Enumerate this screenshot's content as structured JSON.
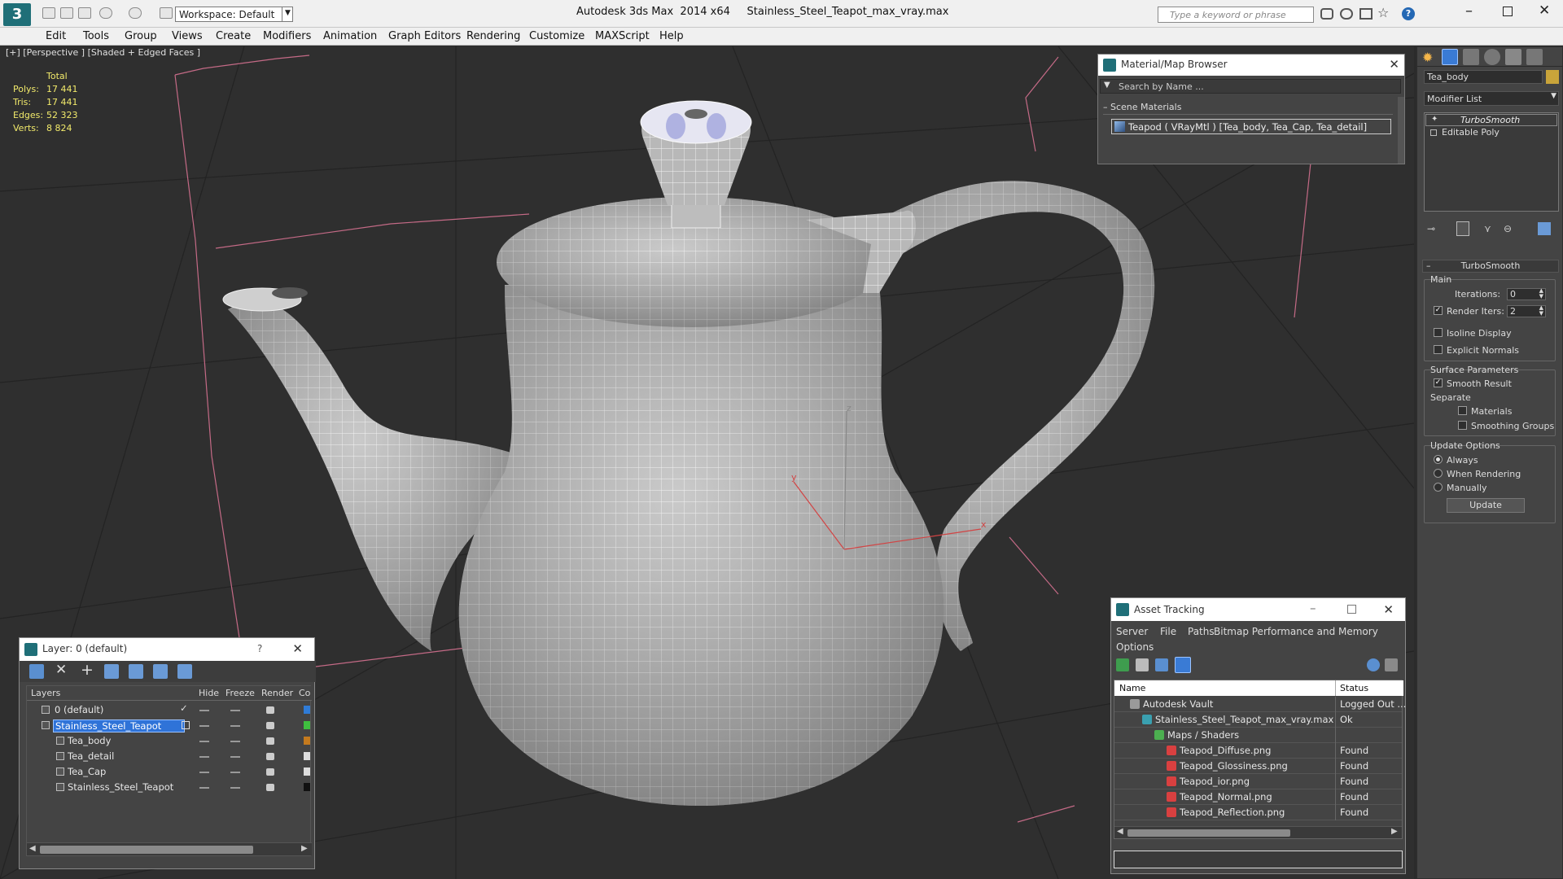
{
  "app": {
    "title": "Autodesk 3ds Max  2014 x64     Stainless_Steel_Teapot_max_vray.max",
    "workspace": "Workspace: Default",
    "search_placeholder": "Type a keyword or phrase"
  },
  "menu": [
    "Edit",
    "Tools",
    "Group",
    "Views",
    "Create",
    "Modifiers",
    "Animation",
    "Graph Editors",
    "Rendering",
    "Customize",
    "MAXScript",
    "Help"
  ],
  "viewport": {
    "label": "[+] [Perspective ] [Shaded + Edged Faces ]",
    "stats_header": "Total",
    "stats": [
      {
        "label": "Polys:",
        "value": "17 441"
      },
      {
        "label": "Tris:",
        "value": "17 441"
      },
      {
        "label": "Edges:",
        "value": "52 323"
      },
      {
        "label": "Verts:",
        "value": "8 824"
      }
    ],
    "axis_x": "x",
    "axis_y": "y",
    "axis_z": "z"
  },
  "material_browser": {
    "title": "Material/Map Browser",
    "search_placeholder": "Search by Name ...",
    "section": "Scene Materials",
    "item": "Teapod  ( VRayMtl ) [Tea_body, Tea_Cap, Tea_detail]"
  },
  "layer_panel": {
    "title": "Layer: 0 (default)",
    "help": "?",
    "columns": [
      "Layers",
      "Hide",
      "Freeze",
      "Render",
      "Co"
    ],
    "rows": [
      {
        "name": "0 (default)",
        "indent": 0,
        "selected": false,
        "color": "#2f7bd6"
      },
      {
        "name": "Stainless_Steel_Teapot",
        "indent": 0,
        "selected": true,
        "color": "#3fbf3f"
      },
      {
        "name": "Tea_body",
        "indent": 1,
        "selected": false,
        "color": "#c47a1e"
      },
      {
        "name": "Tea_detail",
        "indent": 1,
        "selected": false,
        "color": "#dddddd"
      },
      {
        "name": "Tea_Cap",
        "indent": 1,
        "selected": false,
        "color": "#dddddd"
      },
      {
        "name": "Stainless_Steel_Teapot",
        "indent": 1,
        "selected": false,
        "color": "#111111"
      }
    ]
  },
  "asset_tracking": {
    "title": "Asset Tracking",
    "menu": [
      "Server",
      "File",
      "Paths",
      "Bitmap Performance and Memory"
    ],
    "menu2": "Options",
    "columns": [
      "Name",
      "Status"
    ],
    "rows": [
      {
        "name": "Autodesk Vault",
        "status": "Logged Out ...",
        "indent": 1,
        "icon": "vault"
      },
      {
        "name": "Stainless_Steel_Teapot_max_vray.max",
        "status": "Ok",
        "indent": 2,
        "icon": "max"
      },
      {
        "name": "Maps / Shaders",
        "status": "",
        "indent": 3,
        "icon": "maps"
      },
      {
        "name": "Teapod_Diffuse.png",
        "status": "Found",
        "indent": 4,
        "icon": "png"
      },
      {
        "name": "Teapod_Glossiness.png",
        "status": "Found",
        "indent": 4,
        "icon": "png"
      },
      {
        "name": "Teapod_ior.png",
        "status": "Found",
        "indent": 4,
        "icon": "png"
      },
      {
        "name": "Teapod_Normal.png",
        "status": "Found",
        "indent": 4,
        "icon": "png"
      },
      {
        "name": "Teapod_Reflection.png",
        "status": "Found",
        "indent": 4,
        "icon": "png"
      }
    ]
  },
  "command_panel": {
    "object_name": "Tea_body",
    "modifier_list": "Modifier List",
    "stack": [
      "TurboSmooth",
      "Editable Poly"
    ],
    "rollout_title": "TurboSmooth",
    "main": "Main",
    "iterations_label": "Iterations:",
    "iterations_value": "0",
    "render_iters_label": "Render Iters:",
    "render_iters_value": "2",
    "isoline": "Isoline Display",
    "explicit_normals": "Explicit Normals",
    "surface_params": "Surface Parameters",
    "smooth_result": "Smooth Result",
    "separate": "Separate",
    "materials": "Materials",
    "smoothing_groups": "Smoothing Groups",
    "update_options": "Update Options",
    "always": "Always",
    "when_rendering": "When Rendering",
    "manually": "Manually",
    "update_button": "Update"
  },
  "colors": {
    "accent": "#3399ff",
    "selection": "#2f73d8",
    "viewport_bg": "#2f2f2f",
    "panel_dark": "#444444"
  }
}
